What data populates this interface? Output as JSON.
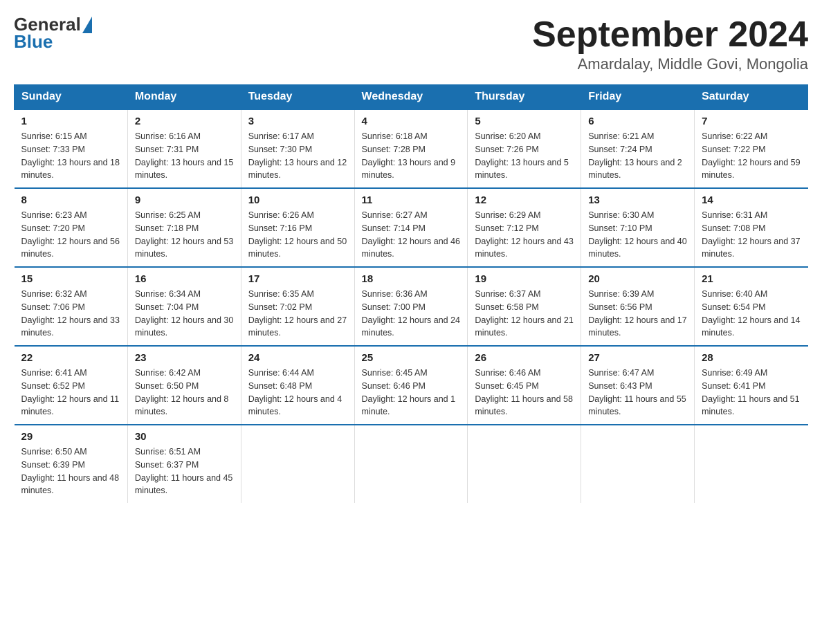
{
  "header": {
    "logo_general": "General",
    "logo_blue": "Blue",
    "title": "September 2024",
    "subtitle": "Amardalay, Middle Govi, Mongolia"
  },
  "days_of_week": [
    "Sunday",
    "Monday",
    "Tuesday",
    "Wednesday",
    "Thursday",
    "Friday",
    "Saturday"
  ],
  "weeks": [
    [
      {
        "day": "1",
        "sunrise": "Sunrise: 6:15 AM",
        "sunset": "Sunset: 7:33 PM",
        "daylight": "Daylight: 13 hours and 18 minutes."
      },
      {
        "day": "2",
        "sunrise": "Sunrise: 6:16 AM",
        "sunset": "Sunset: 7:31 PM",
        "daylight": "Daylight: 13 hours and 15 minutes."
      },
      {
        "day": "3",
        "sunrise": "Sunrise: 6:17 AM",
        "sunset": "Sunset: 7:30 PM",
        "daylight": "Daylight: 13 hours and 12 minutes."
      },
      {
        "day": "4",
        "sunrise": "Sunrise: 6:18 AM",
        "sunset": "Sunset: 7:28 PM",
        "daylight": "Daylight: 13 hours and 9 minutes."
      },
      {
        "day": "5",
        "sunrise": "Sunrise: 6:20 AM",
        "sunset": "Sunset: 7:26 PM",
        "daylight": "Daylight: 13 hours and 5 minutes."
      },
      {
        "day": "6",
        "sunrise": "Sunrise: 6:21 AM",
        "sunset": "Sunset: 7:24 PM",
        "daylight": "Daylight: 13 hours and 2 minutes."
      },
      {
        "day": "7",
        "sunrise": "Sunrise: 6:22 AM",
        "sunset": "Sunset: 7:22 PM",
        "daylight": "Daylight: 12 hours and 59 minutes."
      }
    ],
    [
      {
        "day": "8",
        "sunrise": "Sunrise: 6:23 AM",
        "sunset": "Sunset: 7:20 PM",
        "daylight": "Daylight: 12 hours and 56 minutes."
      },
      {
        "day": "9",
        "sunrise": "Sunrise: 6:25 AM",
        "sunset": "Sunset: 7:18 PM",
        "daylight": "Daylight: 12 hours and 53 minutes."
      },
      {
        "day": "10",
        "sunrise": "Sunrise: 6:26 AM",
        "sunset": "Sunset: 7:16 PM",
        "daylight": "Daylight: 12 hours and 50 minutes."
      },
      {
        "day": "11",
        "sunrise": "Sunrise: 6:27 AM",
        "sunset": "Sunset: 7:14 PM",
        "daylight": "Daylight: 12 hours and 46 minutes."
      },
      {
        "day": "12",
        "sunrise": "Sunrise: 6:29 AM",
        "sunset": "Sunset: 7:12 PM",
        "daylight": "Daylight: 12 hours and 43 minutes."
      },
      {
        "day": "13",
        "sunrise": "Sunrise: 6:30 AM",
        "sunset": "Sunset: 7:10 PM",
        "daylight": "Daylight: 12 hours and 40 minutes."
      },
      {
        "day": "14",
        "sunrise": "Sunrise: 6:31 AM",
        "sunset": "Sunset: 7:08 PM",
        "daylight": "Daylight: 12 hours and 37 minutes."
      }
    ],
    [
      {
        "day": "15",
        "sunrise": "Sunrise: 6:32 AM",
        "sunset": "Sunset: 7:06 PM",
        "daylight": "Daylight: 12 hours and 33 minutes."
      },
      {
        "day": "16",
        "sunrise": "Sunrise: 6:34 AM",
        "sunset": "Sunset: 7:04 PM",
        "daylight": "Daylight: 12 hours and 30 minutes."
      },
      {
        "day": "17",
        "sunrise": "Sunrise: 6:35 AM",
        "sunset": "Sunset: 7:02 PM",
        "daylight": "Daylight: 12 hours and 27 minutes."
      },
      {
        "day": "18",
        "sunrise": "Sunrise: 6:36 AM",
        "sunset": "Sunset: 7:00 PM",
        "daylight": "Daylight: 12 hours and 24 minutes."
      },
      {
        "day": "19",
        "sunrise": "Sunrise: 6:37 AM",
        "sunset": "Sunset: 6:58 PM",
        "daylight": "Daylight: 12 hours and 21 minutes."
      },
      {
        "day": "20",
        "sunrise": "Sunrise: 6:39 AM",
        "sunset": "Sunset: 6:56 PM",
        "daylight": "Daylight: 12 hours and 17 minutes."
      },
      {
        "day": "21",
        "sunrise": "Sunrise: 6:40 AM",
        "sunset": "Sunset: 6:54 PM",
        "daylight": "Daylight: 12 hours and 14 minutes."
      }
    ],
    [
      {
        "day": "22",
        "sunrise": "Sunrise: 6:41 AM",
        "sunset": "Sunset: 6:52 PM",
        "daylight": "Daylight: 12 hours and 11 minutes."
      },
      {
        "day": "23",
        "sunrise": "Sunrise: 6:42 AM",
        "sunset": "Sunset: 6:50 PM",
        "daylight": "Daylight: 12 hours and 8 minutes."
      },
      {
        "day": "24",
        "sunrise": "Sunrise: 6:44 AM",
        "sunset": "Sunset: 6:48 PM",
        "daylight": "Daylight: 12 hours and 4 minutes."
      },
      {
        "day": "25",
        "sunrise": "Sunrise: 6:45 AM",
        "sunset": "Sunset: 6:46 PM",
        "daylight": "Daylight: 12 hours and 1 minute."
      },
      {
        "day": "26",
        "sunrise": "Sunrise: 6:46 AM",
        "sunset": "Sunset: 6:45 PM",
        "daylight": "Daylight: 11 hours and 58 minutes."
      },
      {
        "day": "27",
        "sunrise": "Sunrise: 6:47 AM",
        "sunset": "Sunset: 6:43 PM",
        "daylight": "Daylight: 11 hours and 55 minutes."
      },
      {
        "day": "28",
        "sunrise": "Sunrise: 6:49 AM",
        "sunset": "Sunset: 6:41 PM",
        "daylight": "Daylight: 11 hours and 51 minutes."
      }
    ],
    [
      {
        "day": "29",
        "sunrise": "Sunrise: 6:50 AM",
        "sunset": "Sunset: 6:39 PM",
        "daylight": "Daylight: 11 hours and 48 minutes."
      },
      {
        "day": "30",
        "sunrise": "Sunrise: 6:51 AM",
        "sunset": "Sunset: 6:37 PM",
        "daylight": "Daylight: 11 hours and 45 minutes."
      },
      null,
      null,
      null,
      null,
      null
    ]
  ]
}
